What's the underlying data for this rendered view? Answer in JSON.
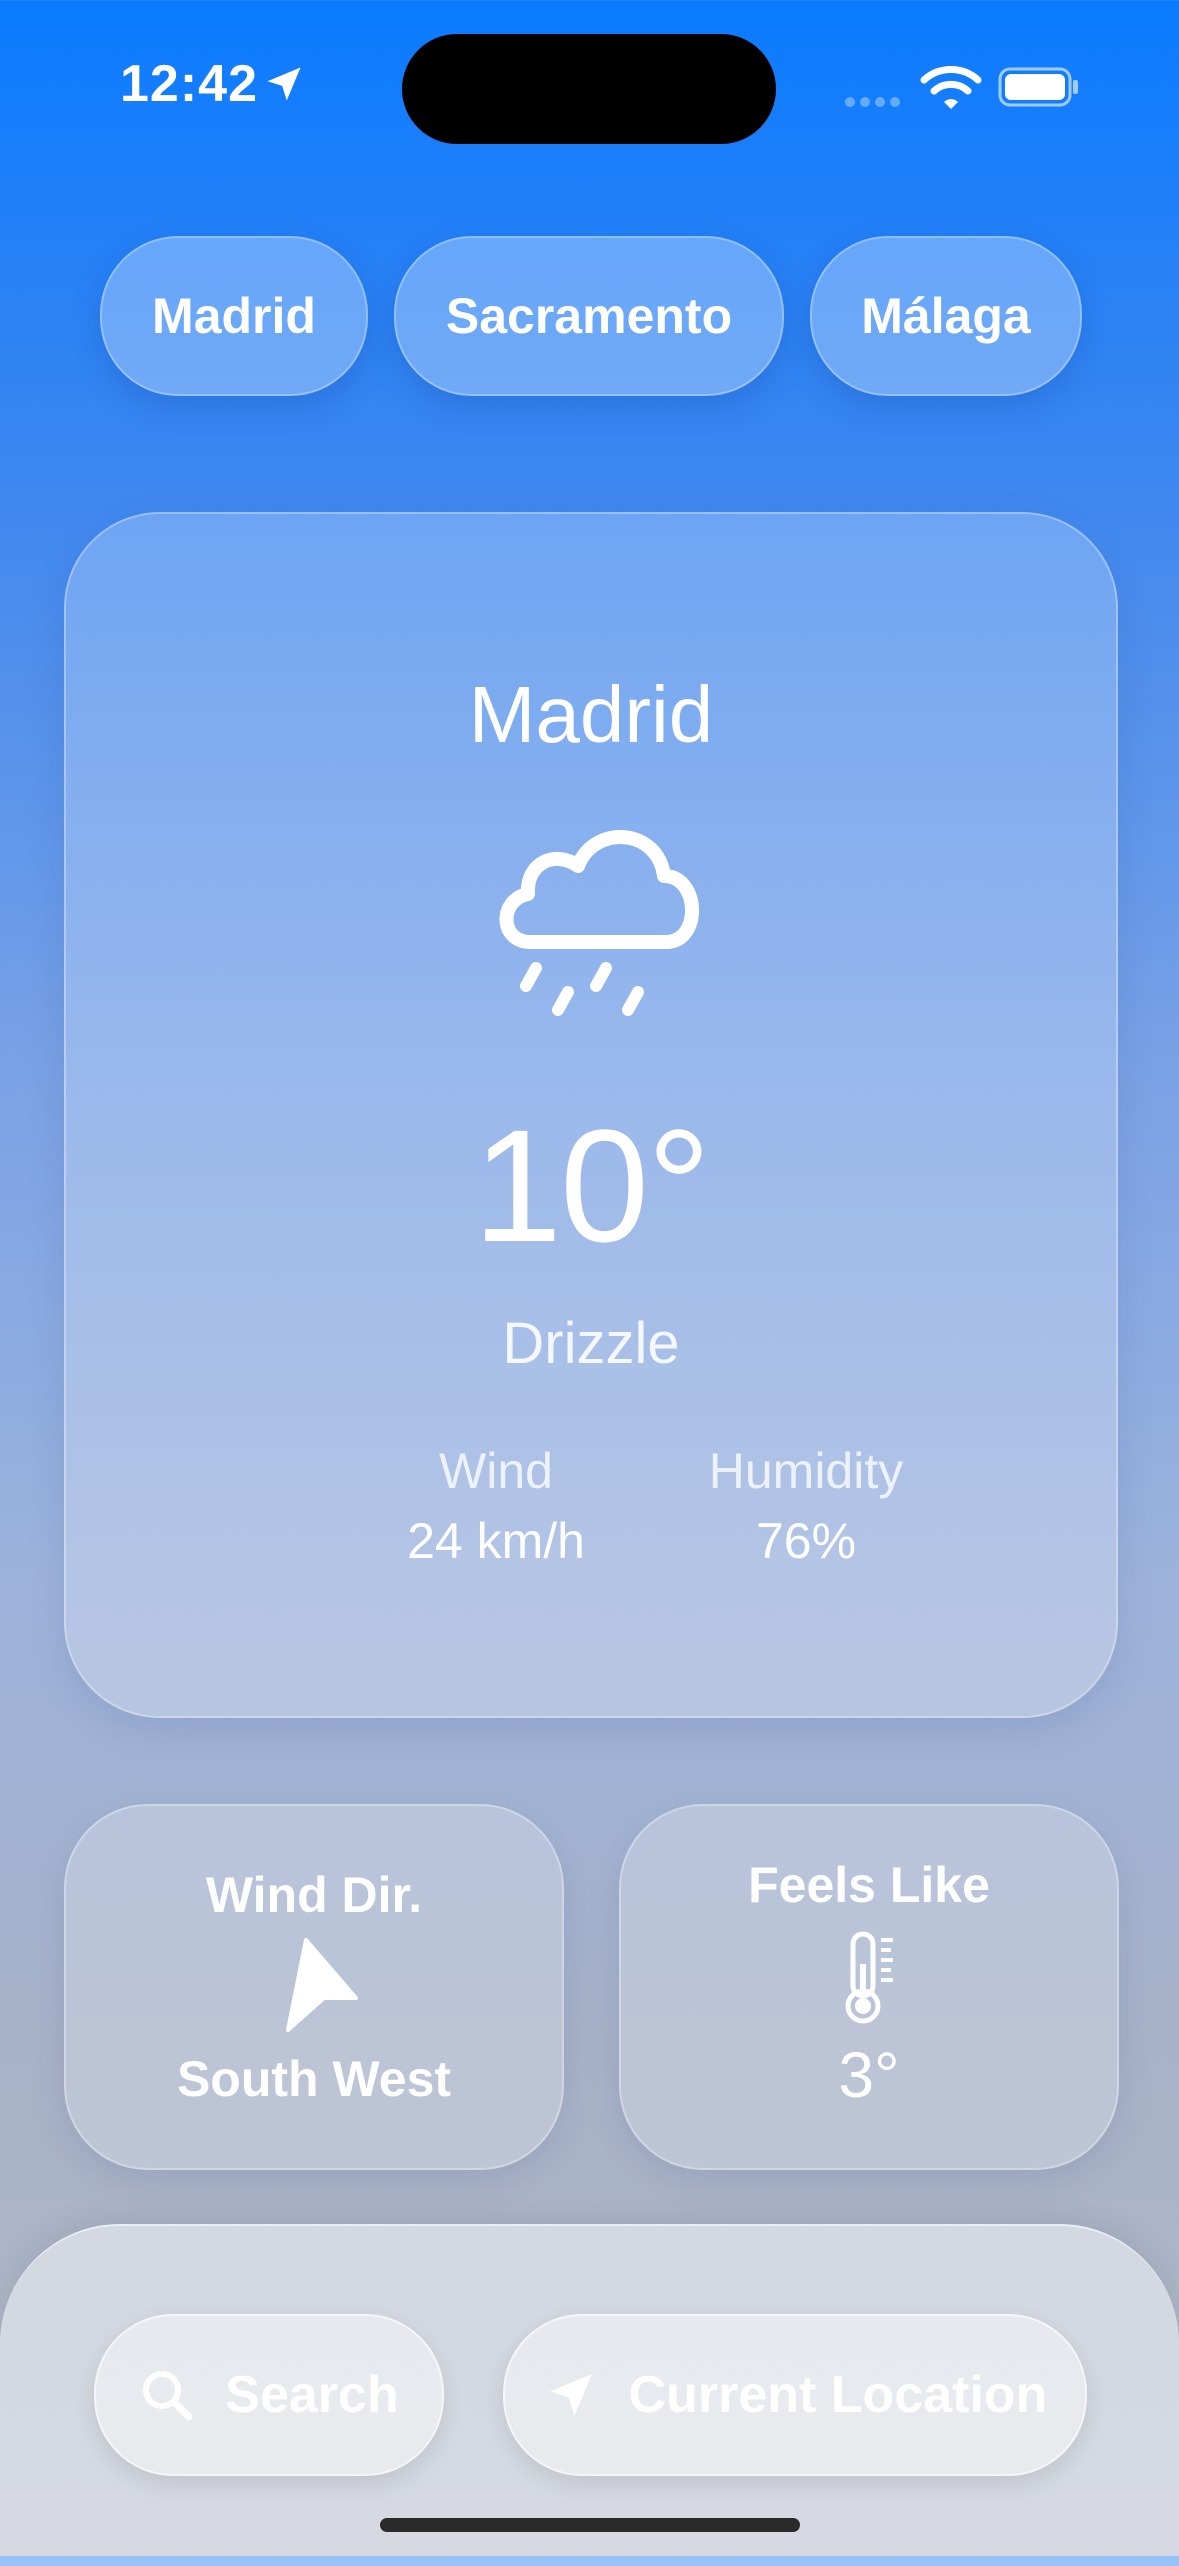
{
  "status_bar": {
    "time": "12:42",
    "location_icon": "location-arrow-icon",
    "wifi_icon": "wifi-icon",
    "battery_icon": "battery-icon"
  },
  "cities": [
    "Madrid",
    "Sacramento",
    "Málaga"
  ],
  "current": {
    "city": "Madrid",
    "icon": "cloud-rain-icon",
    "temperature": "10°",
    "condition": "Drizzle",
    "wind": {
      "label": "Wind",
      "value": "24 km/h"
    },
    "humidity": {
      "label": "Humidity",
      "value": "76%"
    }
  },
  "wind_direction": {
    "title": "Wind Dir.",
    "icon": "direction-arrow-icon",
    "value": "South West"
  },
  "feels_like": {
    "title": "Feels Like",
    "icon": "thermometer-icon",
    "value": "3°"
  },
  "bottom_bar": {
    "search_label": "Search",
    "search_icon": "magnifier-icon",
    "location_label": "Current Location",
    "location_icon": "location-arrow-icon"
  },
  "colors": {
    "gradient_top": "#0a7bff",
    "gradient_bottom": "#b3b9c7",
    "text": "#ffffff"
  }
}
